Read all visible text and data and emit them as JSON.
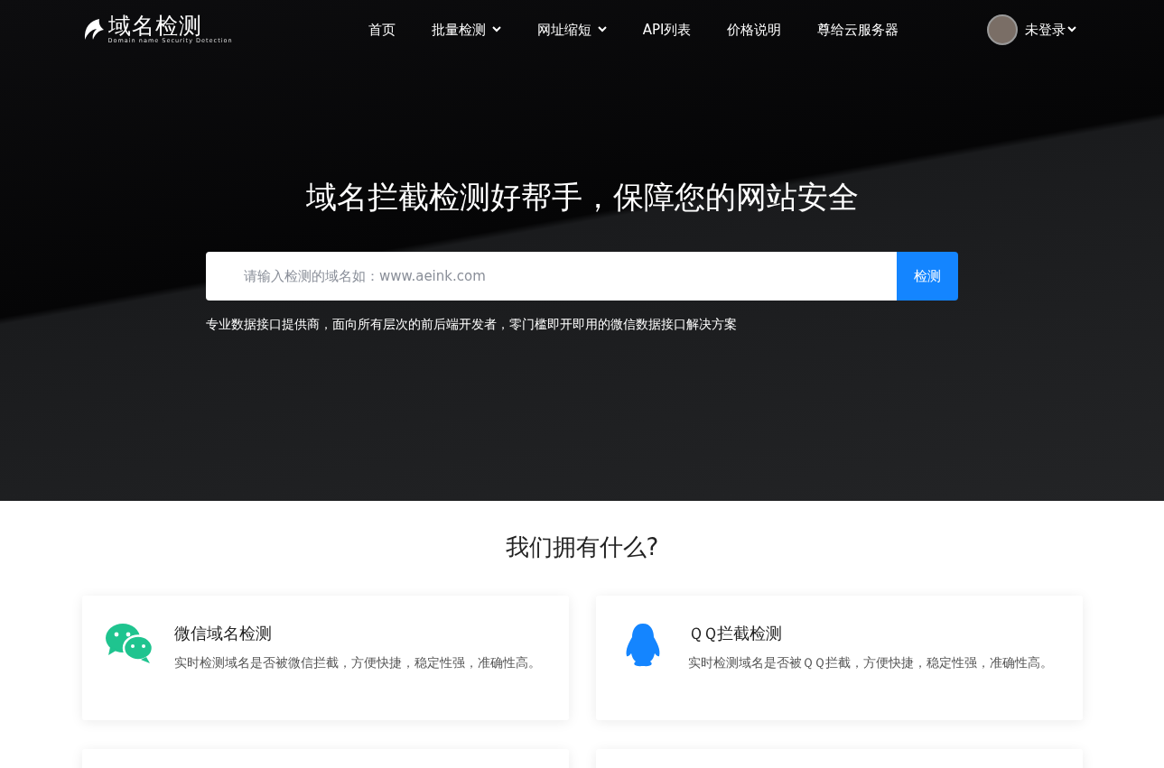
{
  "logo": {
    "title": "域名检测",
    "subtitle": "Domain name Security Detection"
  },
  "nav": [
    {
      "label": "首页",
      "has_menu": false
    },
    {
      "label": "批量检测",
      "has_menu": true
    },
    {
      "label": "网址缩短",
      "has_menu": true
    },
    {
      "label": "API列表",
      "has_menu": false
    },
    {
      "label": "价格说明",
      "has_menu": false
    },
    {
      "label": "尊给云服务器",
      "has_menu": false
    }
  ],
  "user": {
    "label": "未登录",
    "has_menu": true
  },
  "hero": {
    "title": "域名拦截检测好帮手，保障您的网站安全",
    "search": {
      "placeholder": "请输入检测的域名如：www.aeink.com",
      "button": "检测"
    },
    "tagline": "专业数据接口提供商，面向所有层次的前后端开发者，零门槛即开即用的微信数据接口解决方案"
  },
  "features": {
    "title": "我们拥有什么?",
    "items": [
      {
        "kind": "chat",
        "title": "微信域名检测",
        "text": "实时检测域名是否被微信拦截，方便快捷，稳定性强，准确性高。"
      },
      {
        "kind": "penguin",
        "title": "ＱＱ拦截检测",
        "text": "实时检测域名是否被ＱＱ拦截，方便快捷，稳定性强，准确性高。"
      },
      {
        "kind": "blank"
      },
      {
        "kind": "blank"
      }
    ]
  }
}
